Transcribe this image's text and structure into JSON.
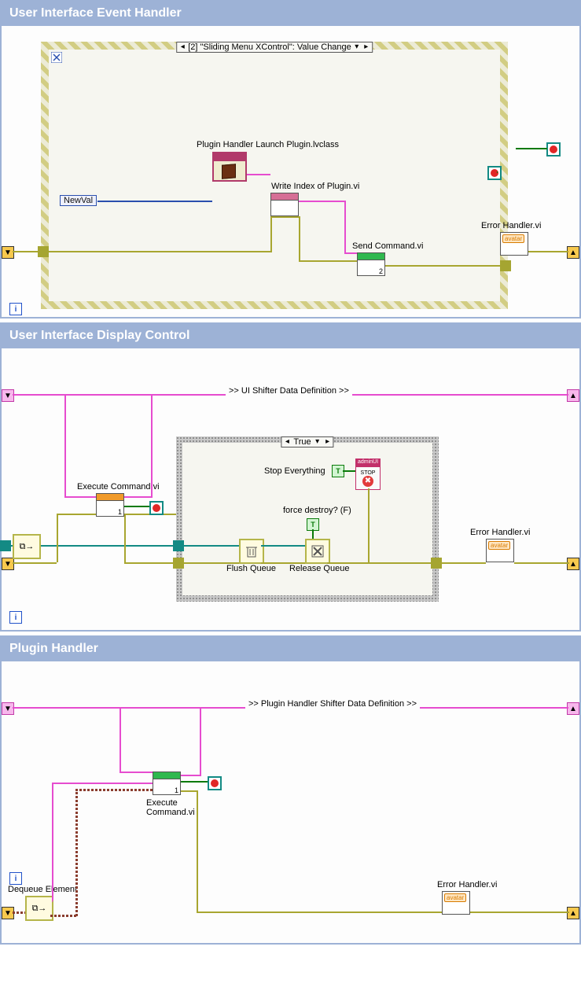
{
  "panel1": {
    "title": "User Interface Event Handler",
    "event_case": "[2] \"Sliding Menu XControl\": Value Change",
    "plugin_class_label": "Plugin Handler Launch Plugin.lvclass",
    "write_index_label": "Write Index of Plugin.vi",
    "send_command_label": "Send Command.vi",
    "send_command_sub": "2",
    "error_handler_label": "Error Handler.vi",
    "newval_label": "NewVal"
  },
  "panel2": {
    "title": "User Interface Display Control",
    "shifter_label": ">> UI Shifter Data Definition >>",
    "case_value": "True",
    "execute_cmd_label": "Execute Command.vi",
    "execute_cmd_sub": "1",
    "stop_label": "Stop Everything",
    "force_destroy_label": "force destroy? (F)",
    "flush_q_label": "Flush Queue",
    "release_q_label": "Release Queue",
    "error_handler_label": "Error Handler.vi",
    "stop_head": "adminUI",
    "stop_text": "STOP"
  },
  "panel3": {
    "title": "Plugin Handler",
    "shifter_label": ">> Plugin Handler Shifter Data Definition >>",
    "execute_cmd_label": "Execute Command.vi",
    "execute_cmd_sub": "1",
    "dequeue_label": "Dequeue Element",
    "error_handler_label": "Error Handler.vi"
  },
  "avatar": "avatar",
  "bool_T": "T"
}
